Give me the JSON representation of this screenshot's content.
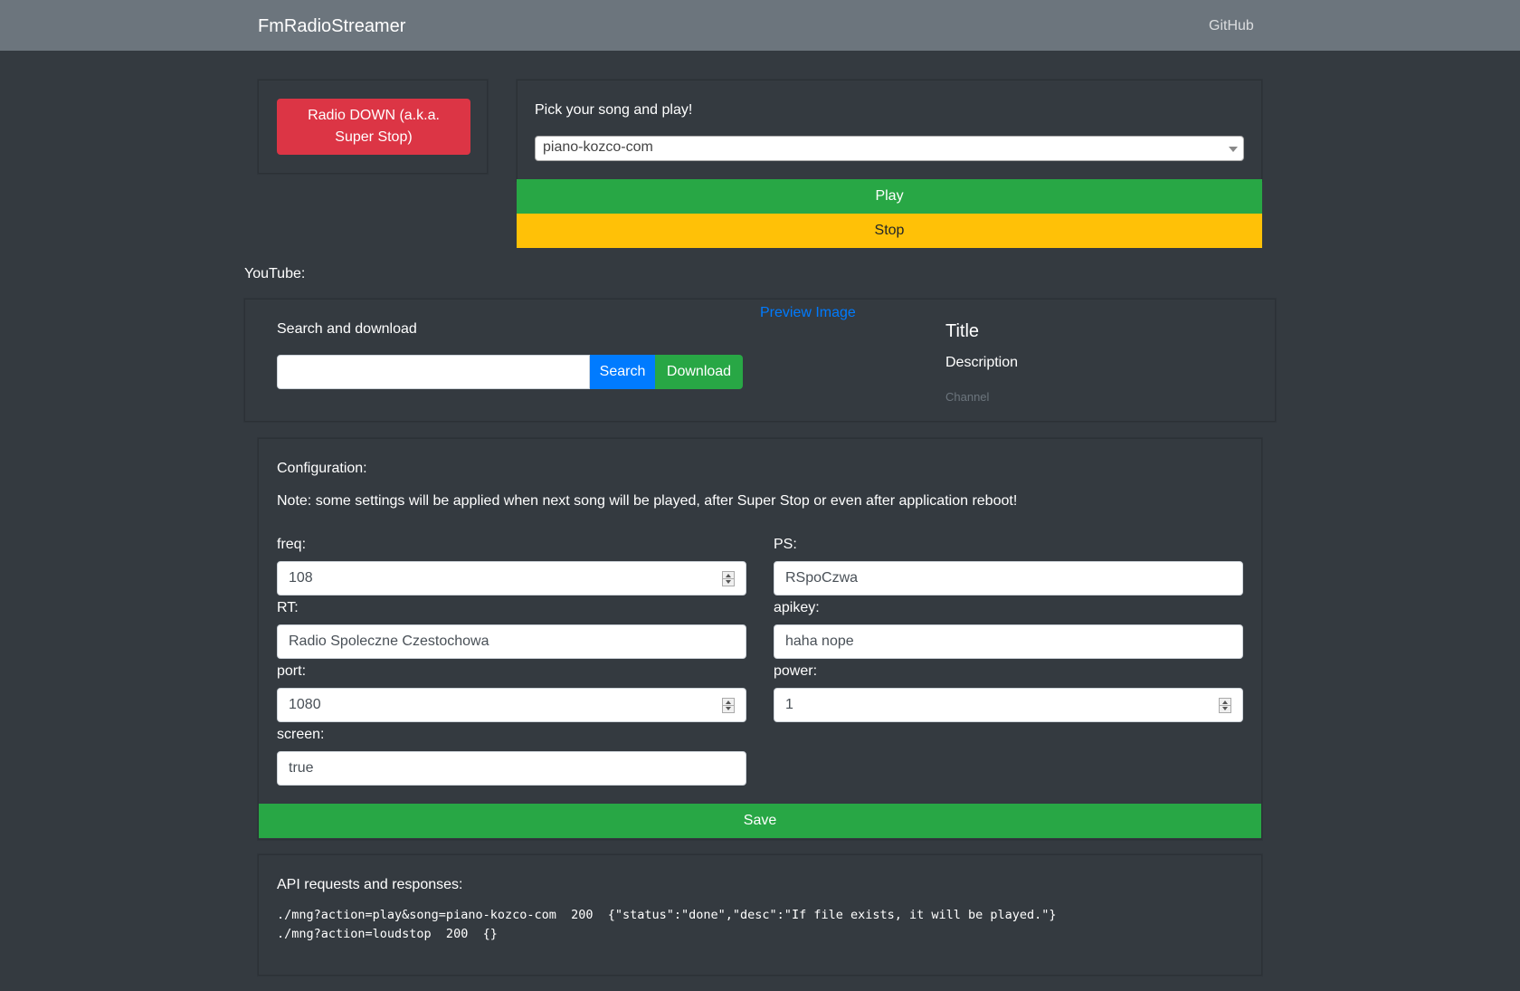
{
  "navbar": {
    "brand": "FmRadioStreamer",
    "github": "GitHub"
  },
  "radio": {
    "super_stop_label": "Radio DOWN (a.k.a. Super Stop)"
  },
  "player": {
    "heading": "Pick your song and play!",
    "selected_song": "piano-kozco-com",
    "play_label": "Play",
    "stop_label": "Stop"
  },
  "youtube": {
    "section_label": "YouTube:",
    "search_heading": "Search and download",
    "search_value": "",
    "search_label": "Search",
    "download_label": "Download",
    "preview_image": "Preview Image",
    "title": "Title",
    "description": "Description",
    "channel": "Channel"
  },
  "config": {
    "heading": "Configuration:",
    "note": "Note: some settings will be applied when next song will be played, after Super Stop or even after application reboot!",
    "freq_label": "freq:",
    "freq_value": "108",
    "ps_label": "PS:",
    "ps_value": "RSpoCzwa",
    "rt_label": "RT:",
    "rt_value": "Radio Spoleczne Czestochowa",
    "apikey_label": "apikey:",
    "apikey_value": "haha nope",
    "port_label": "port:",
    "port_value": "1080",
    "power_label": "power:",
    "power_value": "1",
    "screen_label": "screen:",
    "screen_value": "true",
    "save_label": "Save"
  },
  "api": {
    "heading": "API requests and responses:",
    "lines": [
      "./mng?action=play&song=piano-kozco-com  200  {\"status\":\"done\",\"desc\":\"If file exists, it will be played.\"}",
      "./mng?action=loudstop  200  {}"
    ]
  }
}
